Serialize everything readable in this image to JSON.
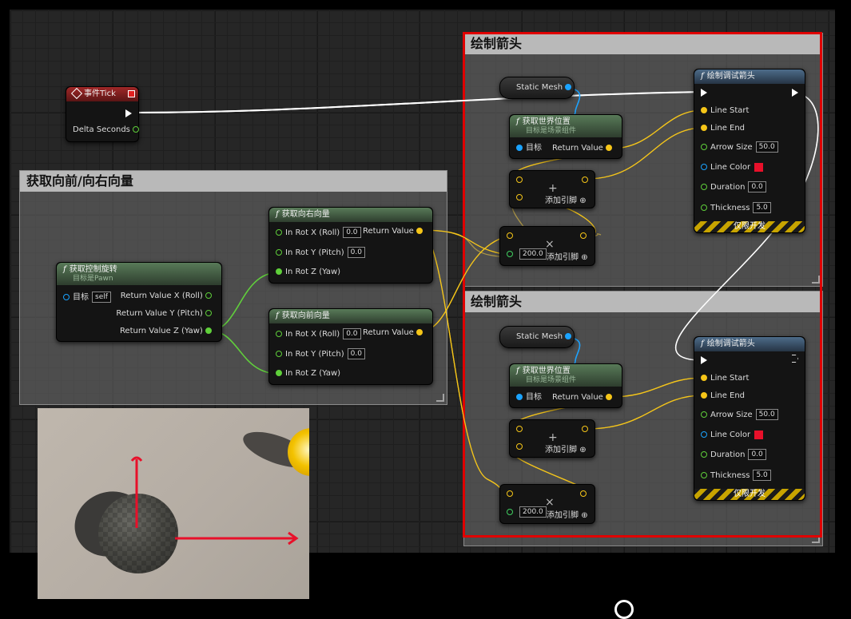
{
  "comment_left": {
    "title": "获取向前/向右向量"
  },
  "comment_top": {
    "title": "绘制箭头"
  },
  "comment_bottom": {
    "title": "绘制箭头"
  },
  "event_tick": {
    "title": "事件Tick",
    "delta_label": "Delta Seconds"
  },
  "get_control_rotation": {
    "title": "获取控制旋转",
    "subtitle": "目标是Pawn",
    "target_label": "目标",
    "target_value": "self",
    "out_x": "Return Value X (Roll)",
    "out_y": "Return Value Y (Pitch)",
    "out_z": "Return Value Z (Yaw)"
  },
  "get_right_vector": {
    "title": "获取向右向量",
    "in_x": "In Rot X (Roll)",
    "in_x_val": "0.0",
    "in_y": "In Rot Y (Pitch)",
    "in_y_val": "0.0",
    "in_z": "In Rot Z (Yaw)",
    "ret": "Return Value"
  },
  "get_forward_vector": {
    "title": "获取向前向量",
    "in_x": "In Rot X (Roll)",
    "in_x_val": "0.0",
    "in_y": "In Rot Y (Pitch)",
    "in_y_val": "0.0",
    "in_z": "In Rot Z (Yaw)",
    "ret": "Return Value"
  },
  "static_mesh": {
    "label": "Static Mesh"
  },
  "get_world_location": {
    "title": "获取世界位置",
    "subtitle": "目标是场景组件",
    "target": "目标",
    "ret": "Return Value"
  },
  "add_node": {
    "symbol": "+",
    "pin_label": "添加引脚",
    "pin_icon": "⊕"
  },
  "mul_node": {
    "symbol": "×",
    "value": "200.0",
    "pin_label": "添加引脚",
    "pin_icon": "⊕"
  },
  "draw_arrow": {
    "title": "绘制调试箭头",
    "line_start": "Line Start",
    "line_end": "Line End",
    "arrow_size": "Arrow Size",
    "arrow_size_val": "50.0",
    "line_color": "Line Color",
    "line_color_hex": "#e8102a",
    "duration": "Duration",
    "duration_val": "0.0",
    "thickness": "Thickness",
    "thickness_val": "5.0",
    "dev_only": "仅限开发"
  },
  "colors": {
    "accent_red": "#e00000",
    "exec_white": "#ffffff",
    "vector_yellow": "#f5c518",
    "float_green": "#5fcf3a",
    "object_blue": "#1ba3ff"
  },
  "icons": [
    "function-icon",
    "event-icon",
    "exec-pin-icon",
    "add-pin-icon",
    "mouse-cursor-icon"
  ]
}
